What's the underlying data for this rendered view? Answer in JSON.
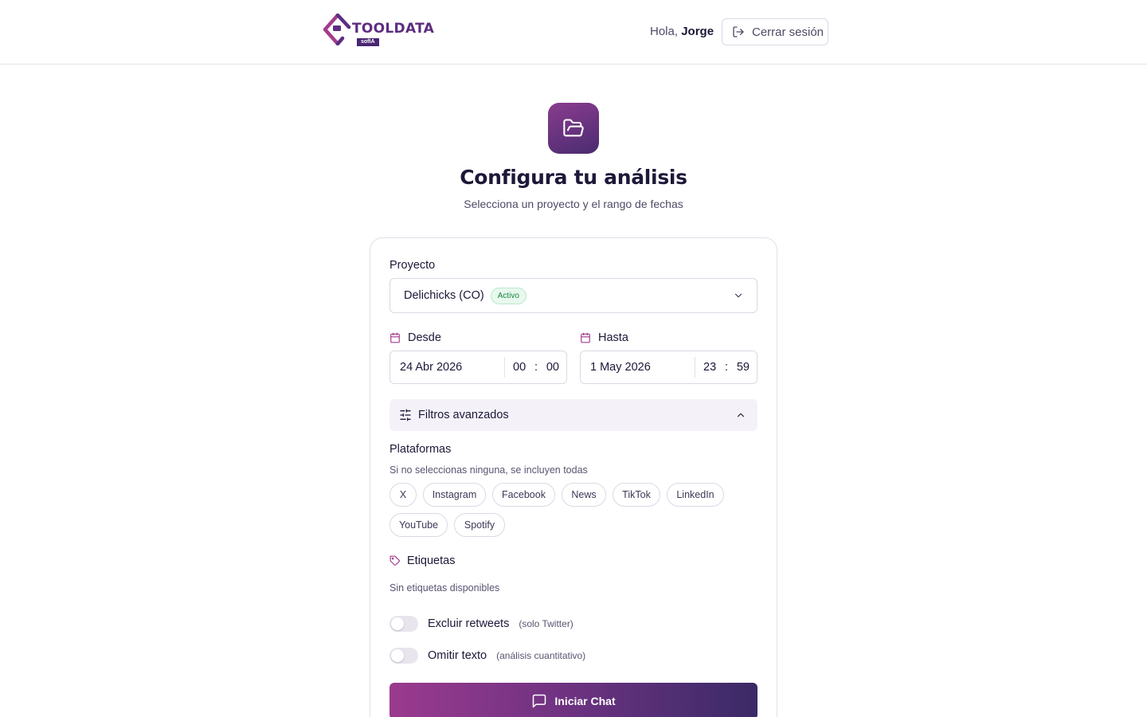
{
  "header": {
    "brand": "TOOLDATA",
    "brand_badge": "sofIA",
    "greeting_prefix": "Hola, ",
    "user_name": "Jorge",
    "logout_label": "Cerrar sesión"
  },
  "hero": {
    "icon": "folder-open-icon",
    "title": "Configura tu análisis",
    "subtitle": "Selecciona un proyecto y el rango de fechas"
  },
  "form": {
    "project_label": "Proyecto",
    "project_value": "Delichicks (CO)",
    "project_status": "Activo",
    "from": {
      "label": "Desde",
      "date": "24 Abr 2026",
      "hour": "00",
      "minute": "00"
    },
    "to": {
      "label": "Hasta",
      "date": "1 May 2026",
      "hour": "23",
      "minute": "59"
    },
    "advanced_filters_label": "Filtros avanzados",
    "platforms_label": "Plataformas",
    "platforms_hint": "Si no seleccionas ninguna, se incluyen todas",
    "platforms": [
      "X",
      "Instagram",
      "Facebook",
      "News",
      "TikTok",
      "LinkedIn",
      "YouTube",
      "Spotify"
    ],
    "tags_label": "Etiquetas",
    "tags_empty": "Sin etiquetas disponibles",
    "toggles": [
      {
        "label": "Excluir retweets",
        "note": "(solo Twitter)",
        "on": false
      },
      {
        "label": "Omitir texto",
        "note": "(análisis cuantitativo)",
        "on": false
      }
    ],
    "submit_label": "Iniciar Chat"
  },
  "colors": {
    "brand_purple": "#5c2d80",
    "accent_magenta": "#a23b8c",
    "gradient_start": "#9b3a8f",
    "gradient_end": "#3a2a66",
    "status_green": "#17883f"
  }
}
